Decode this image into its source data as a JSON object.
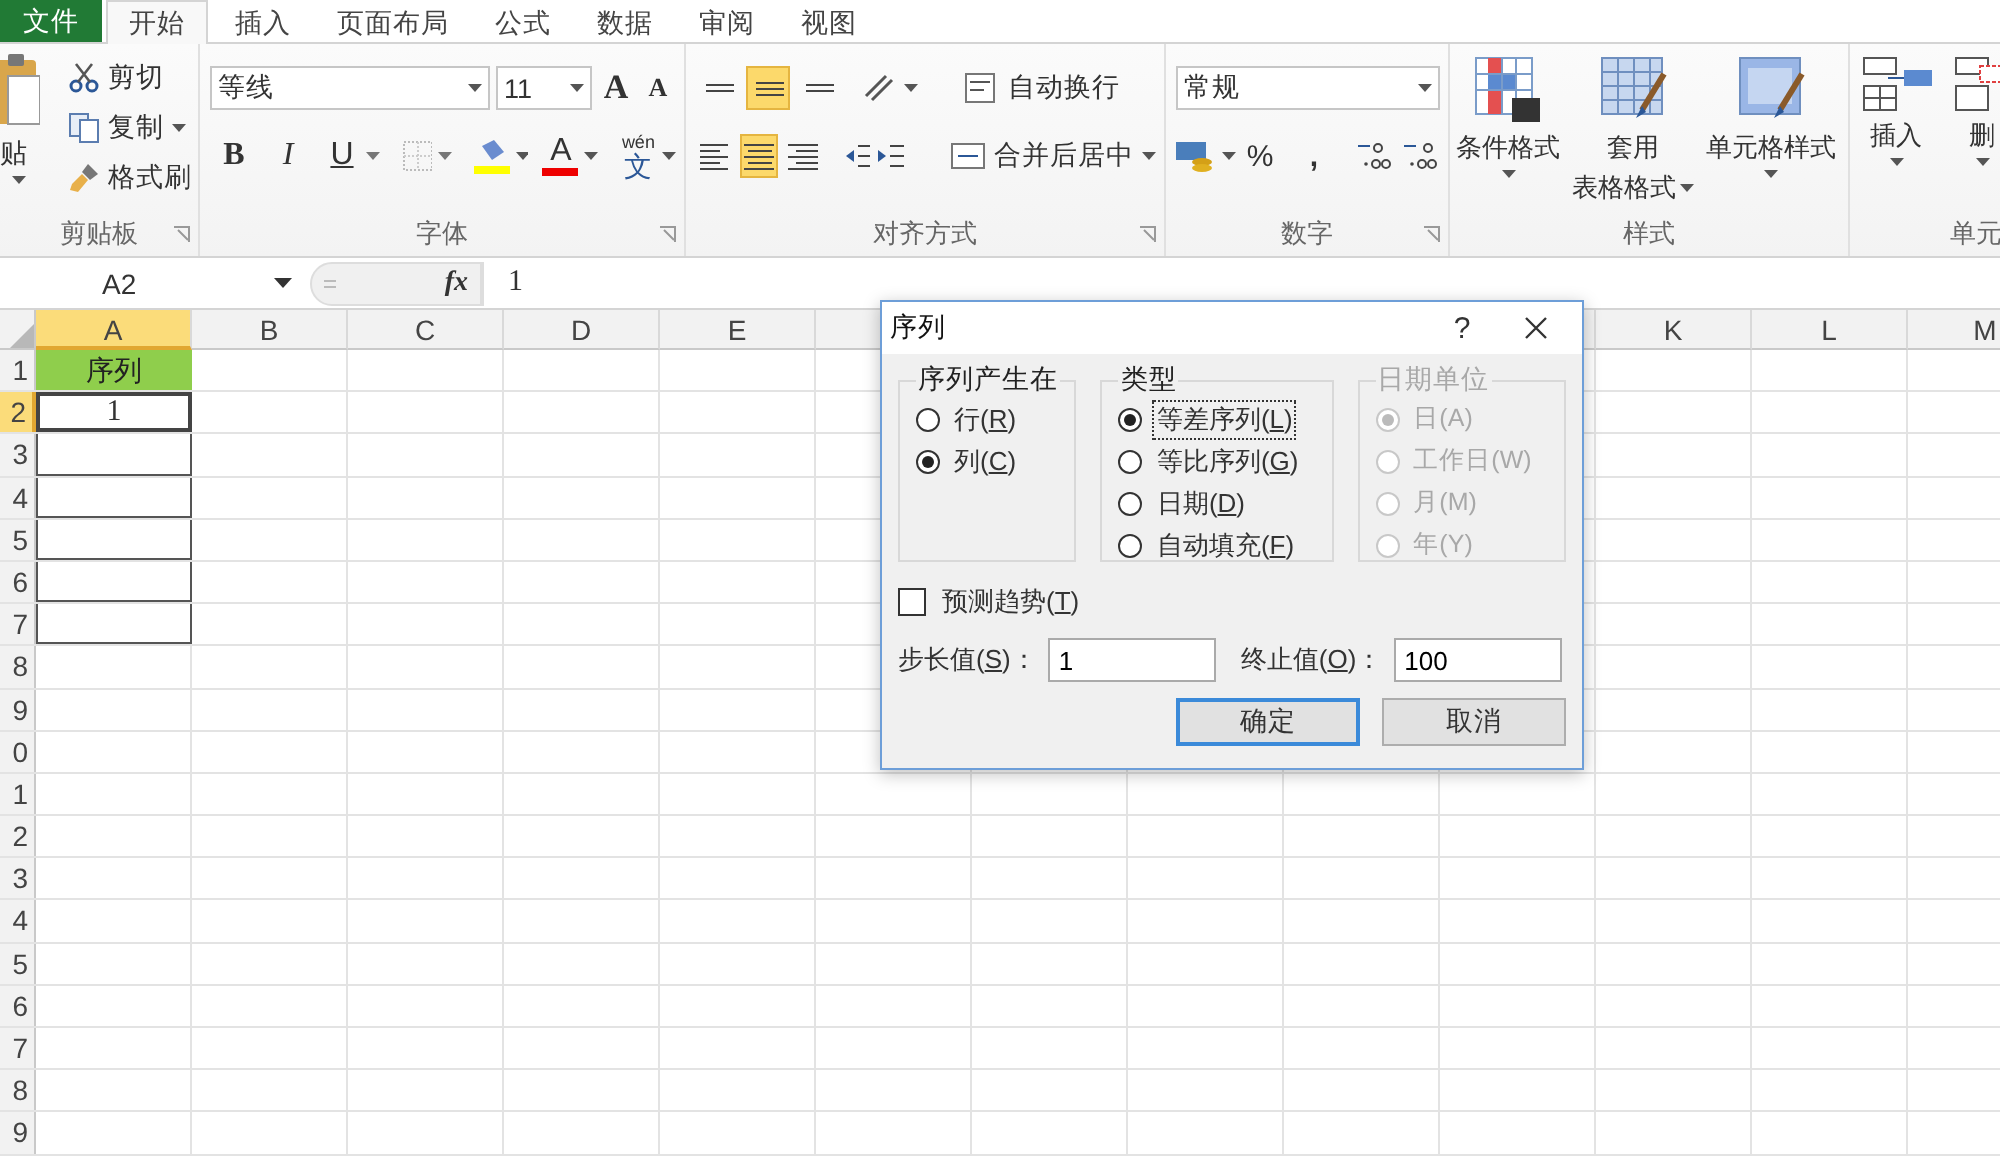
{
  "tabs": [
    {
      "label": "文件",
      "kind": "file",
      "selected": false
    },
    {
      "label": "开始",
      "kind": "tab",
      "selected": true
    },
    {
      "label": "插入",
      "kind": "tab",
      "selected": false
    },
    {
      "label": "页面布局",
      "kind": "tab",
      "selected": false
    },
    {
      "label": "公式",
      "kind": "tab",
      "selected": false
    },
    {
      "label": "数据",
      "kind": "tab",
      "selected": false
    },
    {
      "label": "审阅",
      "kind": "tab",
      "selected": false
    },
    {
      "label": "视图",
      "kind": "tab",
      "selected": false
    }
  ],
  "clipboard": {
    "paste": "贴",
    "cut": "剪切",
    "copy": "复制",
    "format_painter": "格式刷",
    "label": "剪贴板"
  },
  "font": {
    "name": "等线",
    "size": "11",
    "grow": "A",
    "shrink": "A",
    "bold": "B",
    "italic": "I",
    "underline": "U",
    "font_color": "A",
    "phonetic": "文",
    "phonetic_pinyin": "wén",
    "label": "字体"
  },
  "alignment": {
    "vertical": [
      {
        "kind": "top",
        "selected": false
      },
      {
        "kind": "middle",
        "selected": true
      },
      {
        "kind": "bottom",
        "selected": false
      }
    ],
    "horizontal": [
      {
        "kind": "left",
        "selected": false
      },
      {
        "kind": "center",
        "selected": true
      },
      {
        "kind": "right",
        "selected": false
      }
    ],
    "wrap": "自动换行",
    "merge": "合并后居中",
    "label": "对齐方式"
  },
  "number": {
    "format": "常规",
    "percent": "%",
    "comma": ",",
    "label": "数字"
  },
  "styles": {
    "conditional": "条件格式",
    "table_lines": [
      "套用",
      "表格格式"
    ],
    "cell_styles": "单元格样式",
    "label": "样式"
  },
  "cells": {
    "insert": "插入",
    "delete": "删",
    "label": "单元"
  },
  "formula_bar": {
    "name_box": "A2",
    "fx": "fx",
    "value": "1"
  },
  "sheet": {
    "columns": [
      {
        "label": "A",
        "selected": true
      },
      {
        "label": "B",
        "selected": false
      },
      {
        "label": "C",
        "selected": false
      },
      {
        "label": "D",
        "selected": false
      },
      {
        "label": "E",
        "selected": false
      }
    ],
    "right_columns": [
      {
        "label": "K",
        "selected": false
      },
      {
        "label": "L",
        "selected": false
      },
      {
        "label": "M",
        "selected": false
      }
    ],
    "rows": [
      {
        "label": "1",
        "selected": false,
        "cell_a": {
          "kind": "title",
          "text": "序列"
        }
      },
      {
        "label": "2",
        "selected": true,
        "cell_a": {
          "kind": "active",
          "text": "1"
        }
      },
      {
        "label": "3",
        "selected": false,
        "cell_a": {
          "kind": "bordered"
        }
      },
      {
        "label": "4",
        "selected": false,
        "cell_a": {
          "kind": "bordered"
        }
      },
      {
        "label": "5",
        "selected": false,
        "cell_a": {
          "kind": "bordered"
        }
      },
      {
        "label": "6",
        "selected": false,
        "cell_a": {
          "kind": "bordered"
        }
      },
      {
        "label": "7",
        "selected": false,
        "cell_a": {
          "kind": "bordered"
        }
      },
      {
        "label": "8",
        "selected": false
      },
      {
        "label": "9",
        "selected": false
      },
      {
        "label": "0",
        "selected": false
      },
      {
        "label": "1",
        "selected": false
      },
      {
        "label": "2",
        "selected": false
      },
      {
        "label": "3",
        "selected": false
      },
      {
        "label": "4",
        "selected": false
      },
      {
        "label": "5",
        "selected": false
      },
      {
        "label": "6",
        "selected": false
      },
      {
        "label": "7",
        "selected": false
      },
      {
        "label": "8",
        "selected": false
      },
      {
        "label": "9",
        "selected": false
      }
    ]
  },
  "dialog": {
    "title": "序列",
    "help": "?",
    "groups": [
      {
        "title": "序列产生在",
        "disabled": false,
        "options": [
          {
            "label": "行(R)",
            "selected": false,
            "focused": false
          },
          {
            "label": "列(C)",
            "selected": true,
            "focused": false
          }
        ]
      },
      {
        "title": "类型",
        "disabled": false,
        "options": [
          {
            "label": "等差序列(L)",
            "selected": true,
            "focused": true
          },
          {
            "label": "等比序列(G)",
            "selected": false,
            "focused": false
          },
          {
            "label": "日期(D)",
            "selected": false,
            "focused": false
          },
          {
            "label": "自动填充(F)",
            "selected": false,
            "focused": false
          }
        ]
      },
      {
        "title": "日期单位",
        "disabled": true,
        "options": [
          {
            "label": "日(A)",
            "selected": true,
            "focused": false
          },
          {
            "label": "工作日(W)",
            "selected": false,
            "focused": false
          },
          {
            "label": "月(M)",
            "selected": false,
            "focused": false
          },
          {
            "label": "年(Y)",
            "selected": false,
            "focused": false
          }
        ]
      }
    ],
    "trend": {
      "label": "预测趋势(T)",
      "checked": false
    },
    "step": {
      "label": "步长值(S)：",
      "value": "1"
    },
    "stop": {
      "label": "终止值(O)：",
      "value": "100"
    },
    "buttons": [
      {
        "label": "确定",
        "default": true
      },
      {
        "label": "取消",
        "default": false
      }
    ]
  }
}
